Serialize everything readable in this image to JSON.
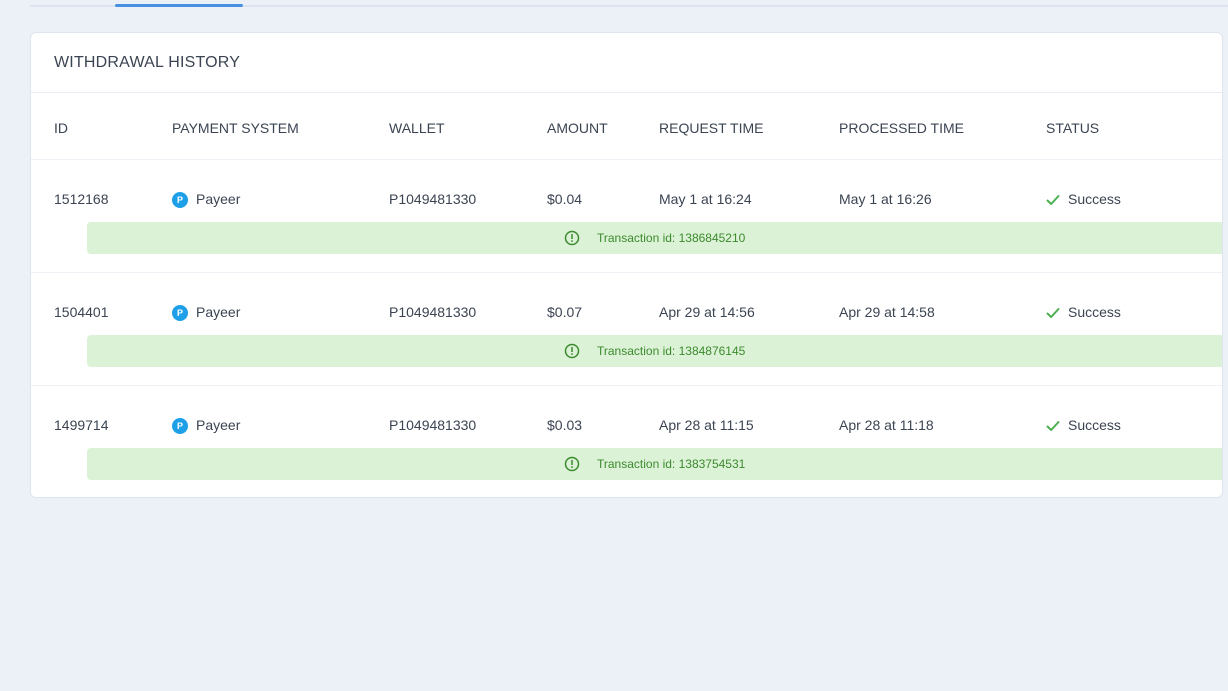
{
  "card": {
    "title": "WITHDRAWAL HISTORY"
  },
  "table": {
    "headers": {
      "id": "ID",
      "payment_system": "PAYMENT SYSTEM",
      "wallet": "WALLET",
      "amount": "AMOUNT",
      "request_time": "REQUEST TIME",
      "processed_time": "PROCESSED TIME",
      "status": "STATUS"
    },
    "rows": [
      {
        "id": "1512168",
        "payment_system": "Payeer",
        "payment_icon_letter": "P",
        "wallet": "P1049481330",
        "amount": "$0.04",
        "request_time": "May 1 at 16:24",
        "processed_time": "May 1 at 16:26",
        "status": "Success",
        "transaction": "Transaction id: 1386845210"
      },
      {
        "id": "1504401",
        "payment_system": "Payeer",
        "payment_icon_letter": "P",
        "wallet": "P1049481330",
        "amount": "$0.07",
        "request_time": "Apr 29 at 14:56",
        "processed_time": "Apr 29 at 14:58",
        "status": "Success",
        "transaction": "Transaction id: 1384876145"
      },
      {
        "id": "1499714",
        "payment_system": "Payeer",
        "payment_icon_letter": "P",
        "wallet": "P1049481330",
        "amount": "$0.03",
        "request_time": "Apr 28 at 11:15",
        "processed_time": "Apr 28 at 11:18",
        "status": "Success",
        "transaction": "Transaction id: 1383754531"
      }
    ]
  },
  "icons": {
    "payment": "payeer-icon",
    "status": "check-icon",
    "transaction": "info-circle-icon"
  },
  "colors": {
    "page_background": "#ecf0f7",
    "card_background": "#ffffff",
    "accent": "#4a90e2",
    "payeer_blue": "#1ea0e8",
    "success_green": "#4caf50",
    "transaction_bar": "#dcf2d6",
    "transaction_text": "#3c8a2e"
  }
}
